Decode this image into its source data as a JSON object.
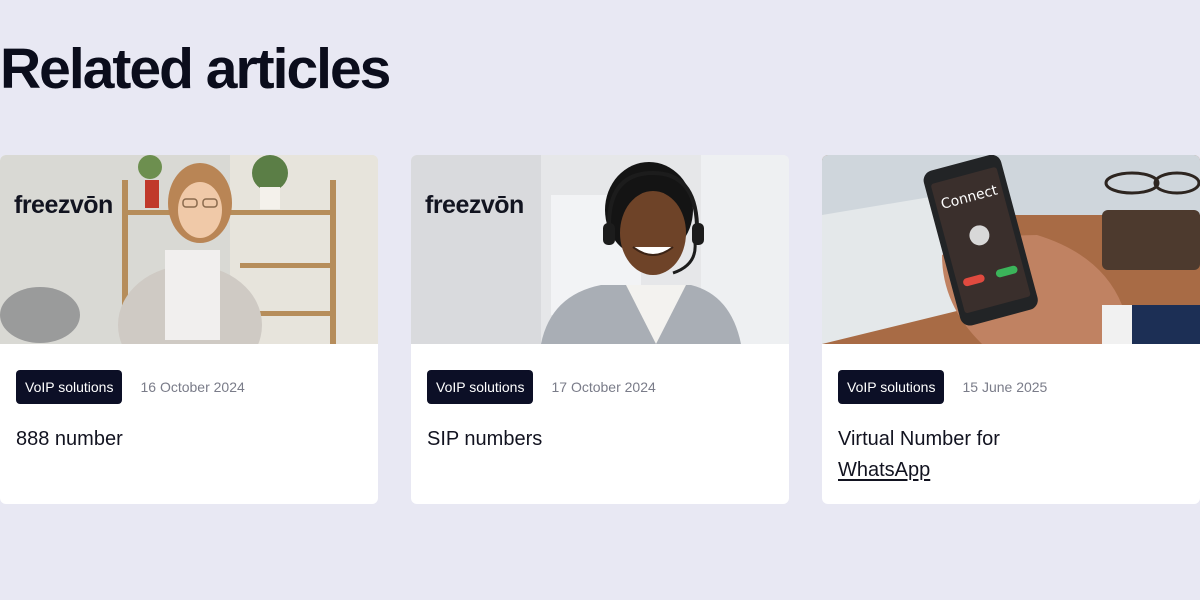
{
  "section": {
    "title": "Related articles"
  },
  "articles": [
    {
      "brand": "freezvōn",
      "tag": "VoIP solutions",
      "date": "16 October 2024",
      "title": "888 number",
      "image": "woman-at-desk-photo"
    },
    {
      "brand": "freezvōn",
      "tag": "VoIP solutions",
      "date": "17 October 2024",
      "title": "SIP numbers",
      "image": "call-center-agent-photo"
    },
    {
      "tag": "VoIP solutions",
      "date": "15 June 2025",
      "title_line1": "Virtual Number for",
      "title_line2": "WhatsApp",
      "image": "phone-connecting-call-photo",
      "phone_screen_text": "Connect"
    }
  ]
}
